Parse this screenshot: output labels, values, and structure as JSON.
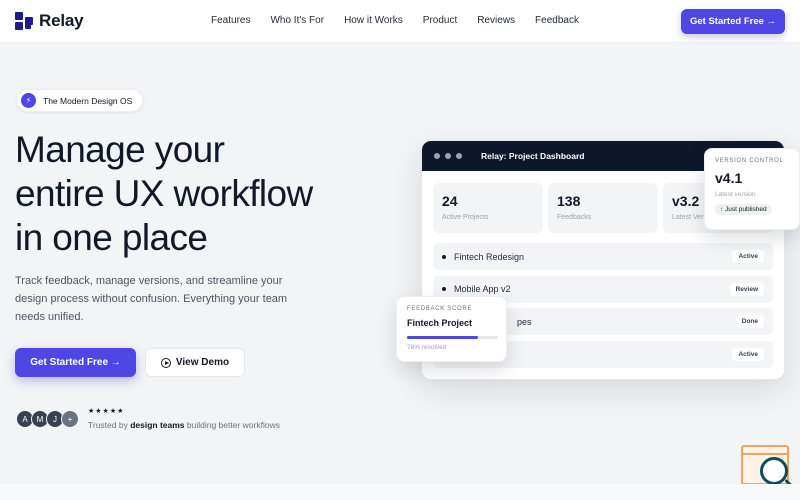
{
  "brand": {
    "name": "Relay",
    "color": "#1e1b8c"
  },
  "nav": {
    "links": [
      "Features",
      "Who It's For",
      "How it Works",
      "Product",
      "Reviews",
      "Feedback"
    ],
    "cta": "Get Started Free →"
  },
  "hero": {
    "badge_icon": "lightning-icon",
    "badge": "The Modern Design OS",
    "title_lines": [
      "Manage your",
      "entire UX workflow",
      "in one place"
    ],
    "subtitle": "Track feedback, manage versions, and streamline your design process without confusion. Everything your team needs unified.",
    "primary_cta": "Get Started Free →",
    "secondary_cta": "View Demo",
    "avatars": [
      "A",
      "M",
      "J",
      "+"
    ],
    "stars": "★★★★★",
    "trusted_prefix": "Trusted by ",
    "trusted_bold": "design teams",
    "trusted_suffix": " building better workflows"
  },
  "dashboard": {
    "title": "Relay: Project Dashboard",
    "stats": [
      {
        "value": "24",
        "label": "Active Projects"
      },
      {
        "value": "138",
        "label": "Feedbacks"
      },
      {
        "value": "v3.2",
        "label": "Latest Ver"
      }
    ],
    "rows": [
      {
        "name": "Fintech Redesign",
        "status": "Active"
      },
      {
        "name": "Mobile App v2",
        "status": "Review"
      },
      {
        "name": "pes",
        "status": "Done"
      },
      {
        "name": "",
        "status": "Active"
      }
    ]
  },
  "version_card": {
    "label": "VERSION CONTROL",
    "value": "v4.1",
    "sub": "Latest version",
    "pill": "↑ Just published"
  },
  "feedback_card": {
    "label": "FEEDBACK SCORE",
    "title": "Fintech Project",
    "progress": 0.78,
    "sub": "78% resolved"
  },
  "colors": {
    "accent": "#4f46e5",
    "dark": "#0f172a"
  }
}
